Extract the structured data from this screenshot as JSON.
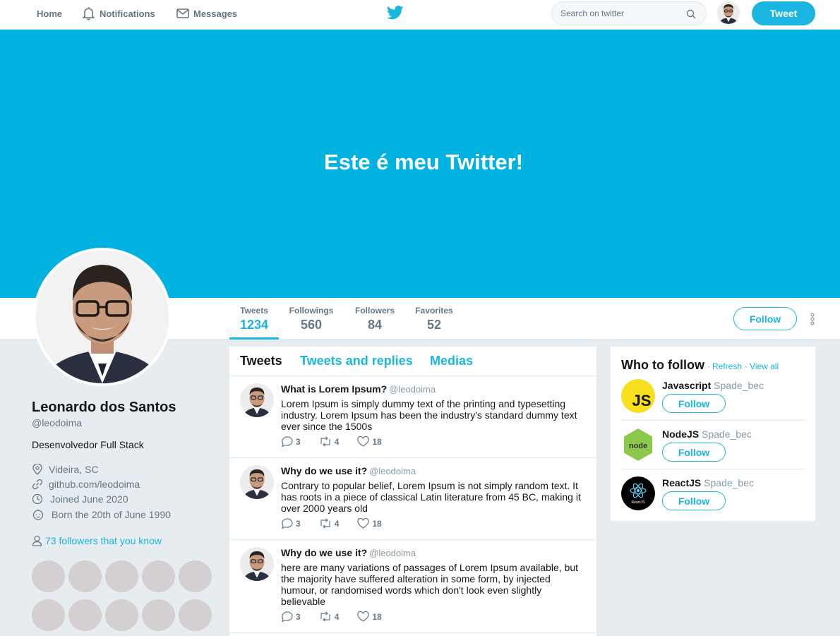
{
  "nav": {
    "home": "Home",
    "notifications": "Notifications",
    "messages": "Messages",
    "search_placeholder": "Search on twitter",
    "tweet_button": "Tweet"
  },
  "banner": {
    "title": "Este é meu Twitter!"
  },
  "stats": [
    {
      "label": "Tweets",
      "value": "1234"
    },
    {
      "label": "Followings",
      "value": "560"
    },
    {
      "label": "Followers",
      "value": "84"
    },
    {
      "label": "Favorites",
      "value": "52"
    }
  ],
  "profile": {
    "follow_button": "Follow",
    "name": "Leonardo dos Santos",
    "handle": "@leodoima",
    "bio": "Desenvolvedor Full Stack",
    "location": "Videira, SC",
    "website": "github.com/leodoima",
    "joined": "Joined June 2020",
    "born": "Born the 20th of June 1990",
    "followers_you_know": "73 followers that you know"
  },
  "timeline": {
    "tabs": [
      "Tweets",
      "Tweets and replies",
      "Medias"
    ],
    "tweets": [
      {
        "title": "What is Lorem Ipsum?",
        "handle": "@leodoima",
        "text": "Lorem Ipsum is simply dummy text of the printing and typesetting industry. Lorem Ipsum has been the industry's standard dummy text ever since the 1500s",
        "replies": "3",
        "retweets": "4",
        "likes": "18"
      },
      {
        "title": "Why do we use it?",
        "handle": "@leodoima",
        "text": "Contrary to popular belief, Lorem Ipsum is not simply random text. It has roots in a piece of classical Latin literature from 45 BC, making it over 2000 years old",
        "replies": "3",
        "retweets": "4",
        "likes": "18"
      },
      {
        "title": "Why do we use it?",
        "handle": "@leodoima",
        "text": "here are many variations of passages of Lorem Ipsum available, but the majority have suffered alteration in some form, by injected humour, or randomised words which don't look even slightly believable",
        "replies": "3",
        "retweets": "4",
        "likes": "18"
      }
    ]
  },
  "who_to_follow": {
    "title": "Who to follow",
    "separator": "·",
    "refresh": "Refresh",
    "view_all": "View all",
    "suggestions": [
      {
        "name": "Javascript",
        "handle": "Spade_bec",
        "button": "Follow",
        "logo_text": "JS"
      },
      {
        "name": "NodeJS",
        "handle": "Spade_bec",
        "button": "Follow",
        "logo_text": "node"
      },
      {
        "name": "ReactJS",
        "handle": "Spade_bec",
        "button": "Follow",
        "logo_text": "ReactJS"
      }
    ]
  },
  "colors": {
    "accent": "#1ab5e1",
    "banner": "#00b2e0",
    "page_background": "#e6ecf0",
    "placeholder_circle": "#d4d0d1"
  }
}
